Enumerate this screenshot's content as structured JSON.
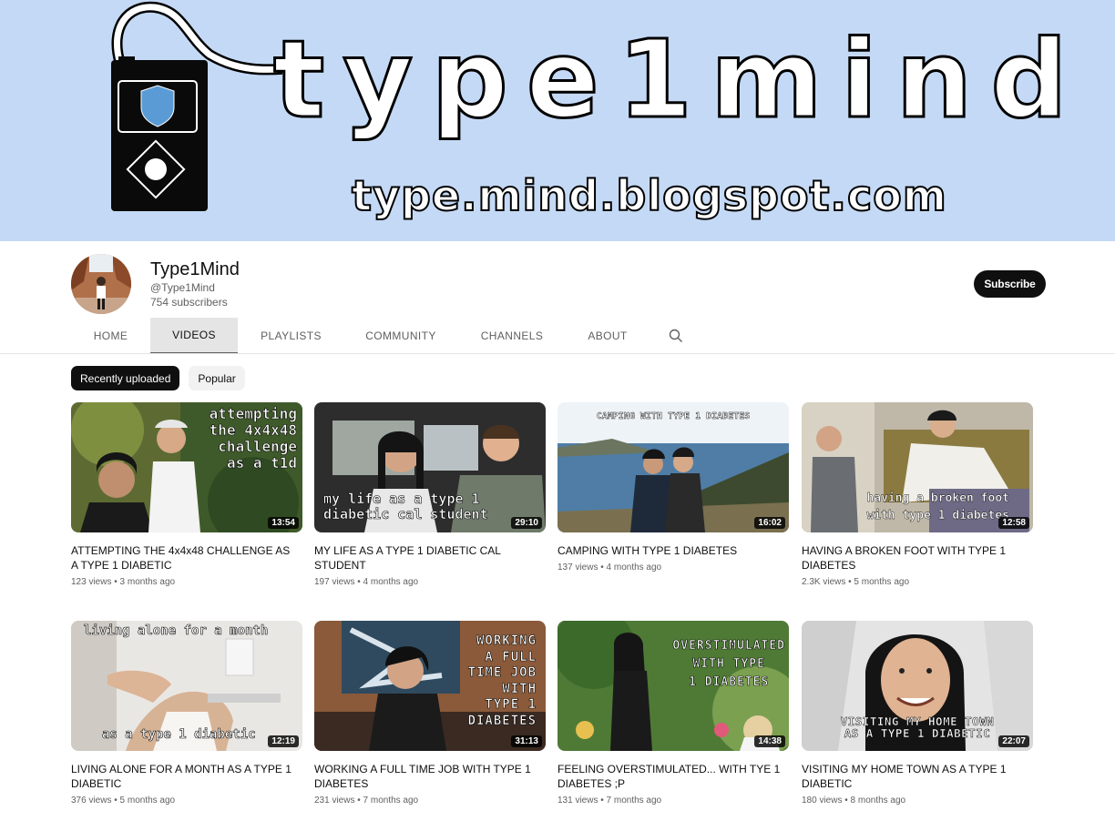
{
  "banner": {
    "title": "type1mind",
    "url": "type.mind.blogspot.com"
  },
  "channel": {
    "name": "Type1Mind",
    "handle": "@Type1Mind",
    "subscribers": "754 subscribers",
    "subscribe_label": "Subscribe"
  },
  "tabs": [
    {
      "label": "HOME"
    },
    {
      "label": "VIDEOS"
    },
    {
      "label": "PLAYLISTS"
    },
    {
      "label": "COMMUNITY"
    },
    {
      "label": "CHANNELS"
    },
    {
      "label": "ABOUT"
    }
  ],
  "chips": [
    {
      "label": "Recently uploaded"
    },
    {
      "label": "Popular"
    }
  ],
  "videos": [
    {
      "title": "ATTEMPTING THE 4x4x48 CHALLENGE AS A TYPE 1 DIABETIC",
      "meta": "123 views • 3 months ago",
      "duration": "13:54",
      "overlay": "attempting\nthe 4x4x48\nchallenge\nas a t1d"
    },
    {
      "title": "MY LIFE AS A TYPE 1 DIABETIC CAL STUDENT",
      "meta": "197 views • 4 months ago",
      "duration": "29:10",
      "overlay": "my life as a type 1\ndiabetic cal student"
    },
    {
      "title": "CAMPING WITH TYPE 1 DIABETES",
      "meta": "137 views • 4 months ago",
      "duration": "16:02",
      "overlay": "CAMPING WITH TYPE 1 DIABETES"
    },
    {
      "title": "HAVING A BROKEN FOOT WITH TYPE 1 DIABETES",
      "meta": "2.3K views • 5 months ago",
      "duration": "12:58",
      "overlay": "having a broken foot\nwith type 1 diabetes"
    },
    {
      "title": "LIVING ALONE FOR A MONTH AS A TYPE 1 DIABETIC",
      "meta": "376 views • 5 months ago",
      "duration": "12:19",
      "overlay_top": "living alone for a month",
      "overlay_bottom": "as a type 1 diabetic"
    },
    {
      "title": "WORKING A FULL TIME JOB WITH TYPE 1 DIABETES",
      "meta": "231 views • 7 months ago",
      "duration": "31:13",
      "overlay": "WORKING\nA FULL\nTIME JOB\nWITH\nTYPE 1\nDIABETES"
    },
    {
      "title": "FEELING OVERSTIMULATED... WITH TYE 1 DIABETES ;P",
      "meta": "131 views • 7 months ago",
      "duration": "14:38",
      "overlay": "OVERSTIMULATED\nWITH TYPE\n1 DIABETES"
    },
    {
      "title": "VISITING MY HOME TOWN AS A TYPE 1 DIABETIC",
      "meta": "180 views • 8 months ago",
      "duration": "22:07",
      "overlay": "VISITING MY HOME TOWN\nAS A TYPE 1 DIABETIC"
    }
  ]
}
